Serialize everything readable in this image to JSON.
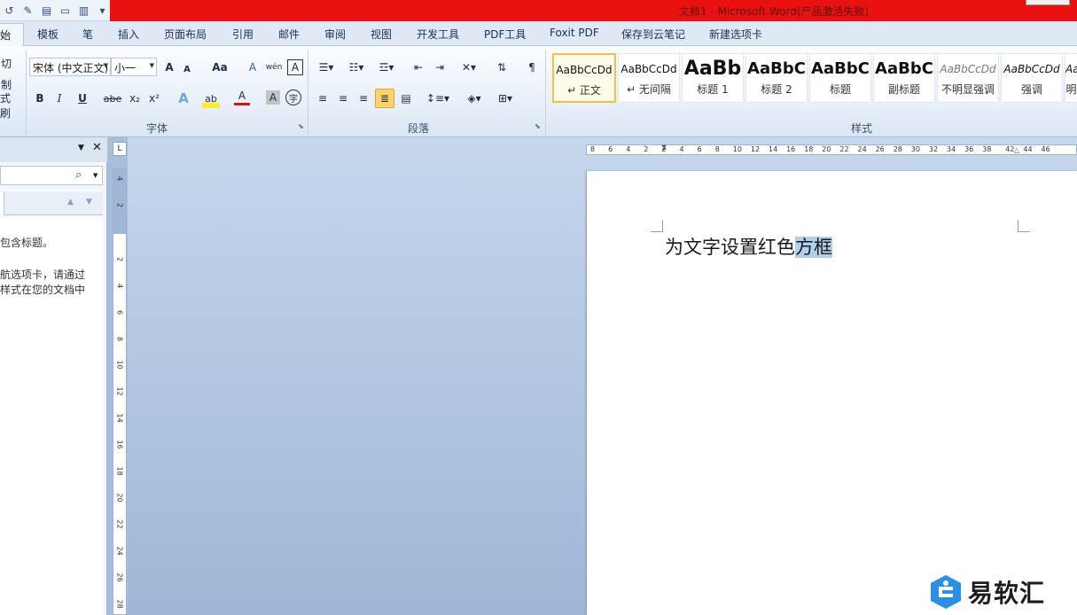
{
  "title_bar": {
    "window_title": "文档1 - Microsoft Word(产品激活失败)",
    "accent_color": "#ea1111"
  },
  "quick_access": [
    "undo-icon",
    "edit-icon",
    "print-preview-icon",
    "new-doc-icon",
    "read-mode-icon",
    "customize-icon"
  ],
  "tabs": {
    "home": "始",
    "items": [
      "模板",
      "笔",
      "插入",
      "页面布局",
      "引用",
      "邮件",
      "审阅",
      "视图",
      "开发工具",
      "PDF工具",
      "Foxit PDF",
      "保存到云笔记",
      "新建选项卡"
    ]
  },
  "clipboard": {
    "cut": "切",
    "copy": "制",
    "format_painter": "式刷"
  },
  "font_group": {
    "label": "字体",
    "font_name": "宋体 (中文正文)",
    "font_size": "小一",
    "bold": "B",
    "italic": "I",
    "underline": "U",
    "strike": "abe",
    "sub": "x₂",
    "sup": "x²",
    "grow": "A",
    "shrink": "A",
    "case": "Aa",
    "clear": "A",
    "phonetic": "wén",
    "border_char": "A",
    "text_effect": "A",
    "highlight": "ab",
    "font_color": "A",
    "shade": "A",
    "enclose": "字"
  },
  "paragraph_group": {
    "label": "段落"
  },
  "styles_group": {
    "label": "样式",
    "items": [
      {
        "preview": "AaBbCcDd",
        "name": "↵ 正文"
      },
      {
        "preview": "AaBbCcDd",
        "name": "↵ 无间隔"
      },
      {
        "preview": "AaBb",
        "name": "标题 1"
      },
      {
        "preview": "AaBbC",
        "name": "标题 2"
      },
      {
        "preview": "AaBbC",
        "name": "标题"
      },
      {
        "preview": "AaBbC",
        "name": "副标题"
      },
      {
        "preview": "AaBbCcDd",
        "name": "不明显强调"
      },
      {
        "preview": "AaBbCcDd",
        "name": "强调"
      },
      {
        "preview": "Aa",
        "name": "明"
      }
    ]
  },
  "nav_pane": {
    "line1": "包含标题。",
    "line2": "航选项卡，请通过",
    "line3": "样式在您的文档中"
  },
  "ruler": {
    "h_numbers": [
      "8",
      "6",
      "4",
      "2",
      "2",
      "4",
      "6",
      "8",
      "10",
      "12",
      "14",
      "16",
      "18",
      "20",
      "22",
      "24",
      "26",
      "28",
      "30",
      "32",
      "34",
      "36",
      "38",
      "42",
      "44",
      "46"
    ],
    "v_numbers": [
      "4",
      "2",
      "2",
      "4",
      "6",
      "8",
      "10",
      "12",
      "14",
      "16",
      "18",
      "20",
      "22",
      "24",
      "26",
      "28"
    ],
    "corner": "L"
  },
  "document": {
    "text_plain": "为文字设置红色",
    "text_selected": "方框"
  },
  "watermark": {
    "text": "易软汇"
  }
}
